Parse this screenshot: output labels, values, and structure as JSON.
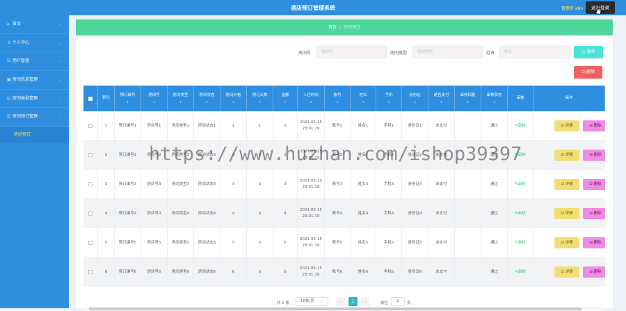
{
  "topbar": {
    "title": "酒店预订管理系统",
    "user_label": "管理员 abo",
    "logout_label": "退出登录"
  },
  "sidebar": {
    "items": [
      {
        "icon": "home-icon",
        "label": "首页"
      },
      {
        "icon": "user-icon",
        "label": "个人中心"
      },
      {
        "icon": "users-icon",
        "label": "用户管理"
      },
      {
        "icon": "room-icon",
        "label": "房间信息管理"
      },
      {
        "icon": "category-icon",
        "label": "房间类型管理"
      },
      {
        "icon": "booking-icon",
        "label": "房间预订管理"
      }
    ],
    "active_sub": "房间预订"
  },
  "breadcrumb": {
    "home": "首页",
    "current": "房间预订"
  },
  "search": {
    "room_no_label": "房间号",
    "room_no_placeholder": "房间号",
    "room_type_label": "房间类型",
    "room_type_placeholder": "房间类型",
    "name_label": "姓名",
    "name_placeholder": "姓名",
    "query_label": "查询",
    "delete_label": "删除"
  },
  "table": {
    "headers": [
      "索引",
      "预订编号",
      "房间号",
      "房间类型",
      "房间状态",
      "房间价格",
      "预订天数",
      "金额",
      "入住时间",
      "账号",
      "姓名",
      "手机",
      "身份证",
      "是否支付",
      "审核回复",
      "审核状态",
      "审核",
      "操作"
    ],
    "rows": [
      [
        "1",
        "预订编号1",
        "房间号1",
        "房间类型1",
        "房间状态1",
        "1",
        "1",
        "1",
        "2021-05-15 23:01:19",
        "账号1",
        "姓名1",
        "手机1",
        "身份证1",
        "未支付",
        "",
        "通过"
      ],
      [
        "2",
        "预订编号2",
        "房间号2",
        "房间类型2",
        "房间状态2",
        "2",
        "2",
        "2",
        "2021-05-15 23:01:19",
        "账号2",
        "姓名2",
        "手机2",
        "身份证2",
        "未支付",
        "",
        "通过"
      ],
      [
        "3",
        "预订编号3",
        "房间号3",
        "房间类型3",
        "房间状态3",
        "3",
        "3",
        "3",
        "2021-05-15 23:01:19",
        "账号3",
        "姓名3",
        "手机3",
        "身份证3",
        "未支付",
        "",
        "通过"
      ],
      [
        "4",
        "预订编号4",
        "房间号4",
        "房间类型4",
        "房间状态4",
        "4",
        "4",
        "4",
        "2021-05-15 23:01:19",
        "账号4",
        "姓名4",
        "手机4",
        "身份证4",
        "未支付",
        "",
        "通过"
      ],
      [
        "5",
        "预订编号5",
        "房间号5",
        "房间类型5",
        "房间状态5",
        "5",
        "5",
        "5",
        "2021-05-15 23:01:19",
        "账号5",
        "姓名5",
        "手机5",
        "身份证5",
        "未支付",
        "",
        "通过"
      ],
      [
        "6",
        "预订编号6",
        "房间号6",
        "房间类型6",
        "房间状态6",
        "6",
        "6",
        "6",
        "2021-05-15 23:01:19",
        "账号6",
        "姓名6",
        "手机6",
        "身份证6",
        "未支付",
        "",
        "通过"
      ]
    ],
    "audit_label": "审核",
    "detail_label": "详情",
    "delete_label": "删除"
  },
  "pagination": {
    "total_text": "共 6 条",
    "page_size": "10条/页",
    "current": "1",
    "goto_label": "前往",
    "goto_value": "1",
    "page_suffix": "页"
  },
  "watermark": "https://www.huzhan.com/ishop39397",
  "colors": {
    "primary": "#2f8ee0",
    "breadcrumb": "#4fd69c",
    "query": "#4be3d7",
    "danger": "#f0605f",
    "detail": "#f3dd76",
    "row_delete": "#f08be4",
    "pager_active": "#2fb6c6"
  }
}
